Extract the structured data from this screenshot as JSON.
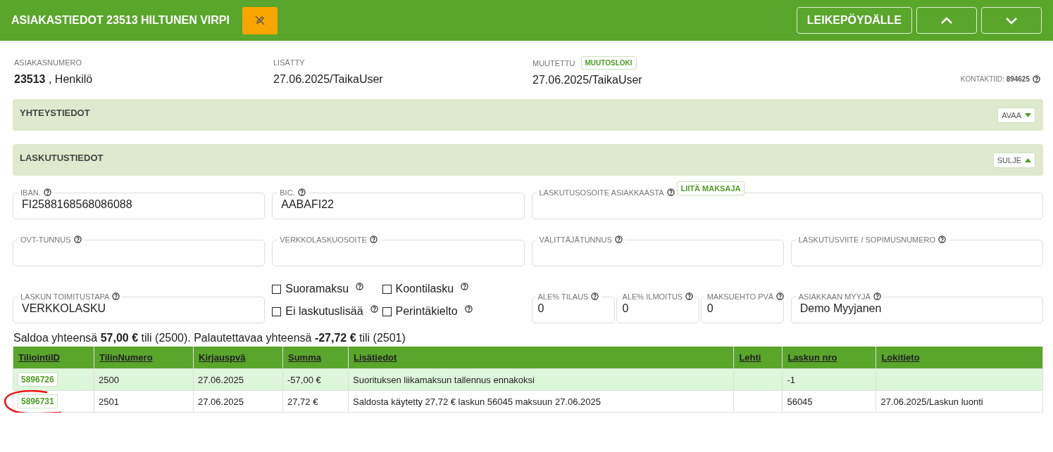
{
  "header": {
    "title": "ASIAKASTIEDOT 23513 HILTUNEN VIRPI",
    "clipboard_button": "LEIKEPÖYDÄLLE"
  },
  "meta": [
    {
      "label": "ASIAKASNUMERO",
      "value": "**23513** , Henkilö"
    },
    {
      "label": "LISÄTTY",
      "value": "27.06.2025/TaikaUser"
    },
    {
      "label": "MUUTETTU",
      "badge": "MUUTOSLOKI",
      "value": "27.06.2025/TaikaUser"
    }
  ],
  "contact_id": "KONTAKTIID: **894625**",
  "sections": [
    {
      "title": "YHTEYSTIEDOT",
      "toggle": "AVAA",
      "expanded": false
    },
    {
      "title": "LASKUTUSTIEDOT",
      "toggle": "SULJE",
      "expanded": true
    }
  ],
  "form_rows": [
    [
      {
        "kind": "field",
        "label": "IBAN.",
        "value": "FI2588168568086088"
      },
      {
        "kind": "field",
        "label": "BIC.",
        "value": "AABAFI22"
      },
      {
        "kind": "wide",
        "label": "LASKUTUSOSOITE ASIAKKAASTA",
        "action": "LIITÄ MAKSAJA"
      }
    ],
    [
      {
        "kind": "field",
        "label": "OVT-TUNNUS"
      },
      {
        "kind": "field",
        "label": "VERKKOLASKUOSOITE"
      },
      {
        "kind": "field",
        "label": "VÄLITTÄJÄTUNNUS"
      },
      {
        "kind": "field",
        "label": "LASKUTUSVIITE / SOPIMUSNUMERO"
      }
    ],
    [
      {
        "kind": "field",
        "label": "LASKUN TOIMITUSTAPA",
        "value": "VERKKOLASKU"
      },
      {
        "kind": "checks",
        "items": [
          {
            "label": "Suoramaksu",
            "checked": false
          },
          {
            "label": "Koontilasku",
            "checked": false
          },
          {
            "label": "Ei laskutuslisää",
            "checked": false
          },
          {
            "label": "Perintäkielto",
            "checked": false
          }
        ]
      },
      {
        "kind": "group",
        "fields": [
          {
            "label": "ALE% TILAUS",
            "value": "0"
          },
          {
            "label": "ALE% ILMOITUS",
            "value": "0"
          },
          {
            "label": "MAKSUEHTO PVÄ",
            "value": "0"
          }
        ]
      },
      {
        "kind": "field",
        "label": "ASIAKKAAN MYYJÄ",
        "value": "Demo Myyjanen"
      }
    ]
  ],
  "summary": "Saldoa yhteensä **57,00 €** tili (2500). Palautettavaa yhteensä **-27,72 €** tili (2501)",
  "table": {
    "columns": [
      "TiliointiID",
      "TilinNumero",
      "Kirjauspvä",
      "Summa",
      "Lisätiedot",
      "Lehti",
      "Laskun nro",
      "Lokitieto"
    ],
    "rows": [
      {
        "selected": true,
        "cells": [
          "5896726",
          "2500",
          "27.06.2025",
          "-57,00 €",
          "Suorituksen liikamaksun tallennus ennakoksi",
          "",
          "-1",
          ""
        ]
      },
      {
        "selected": false,
        "cells": [
          "5896731",
          "2501",
          "27.06.2025",
          "27,72 €",
          "Saldosta käytetty 27,72 € laskun 56045 maksuun 27.06.2025",
          "",
          "56045",
          "27.06.2025/Laskun luonti"
        ]
      }
    ]
  }
}
